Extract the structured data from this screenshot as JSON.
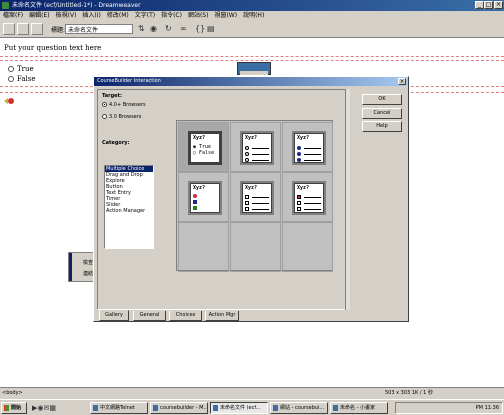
{
  "window": {
    "title": "未命名文件 (ecf/Untitled-1*) - Dreamweaver",
    "min_label": "_",
    "max_label": "□",
    "close_label": "×"
  },
  "menu": [
    "檔案(F)",
    "編輯(E)",
    "檢視(V)",
    "插入(I)",
    "修改(M)",
    "文字(T)",
    "指令(C)",
    "網站(S)",
    "視窗(W)",
    "說明(H)"
  ],
  "toolbar": {
    "title_label": "標題:",
    "title_value": "未命名文件"
  },
  "document": {
    "question": "Put your question text here",
    "option_true": "True",
    "option_false": "False",
    "side_panel_line1": "檢查",
    "side_panel_line2": "連結"
  },
  "dialog": {
    "title": "CourseBuilder Interaction",
    "close_label": "×",
    "target_label": "Target:",
    "target_option1": "4.0+ Browsers",
    "target_option2": "3.0 Browsers",
    "category_label": "Category:",
    "categories": [
      "Multiple Choice",
      "Drag and Drop",
      "Explore",
      "Button",
      "Text Entry",
      "Timer",
      "Slider",
      "Action Manager"
    ],
    "gallery_caption": "Xyz?",
    "gallery_tf_true": "True",
    "gallery_tf_false": "False",
    "buttons": {
      "ok": "OK",
      "cancel": "Cancel",
      "help": "Help"
    },
    "tabs": [
      "Gallery",
      "General",
      "Choices",
      "Action Mgr"
    ]
  },
  "statusbar": {
    "left": "<body>",
    "right": "503 x 303  1K / 1 秒"
  },
  "taskbar": {
    "start": "開始",
    "tasks": [
      "中文網路Telnet",
      "coursebuilder - M...",
      "未命名文件 (ecf...",
      "網站 - coursebui...",
      "未命名 - 小畫家"
    ],
    "clock": "PM 11:36"
  }
}
